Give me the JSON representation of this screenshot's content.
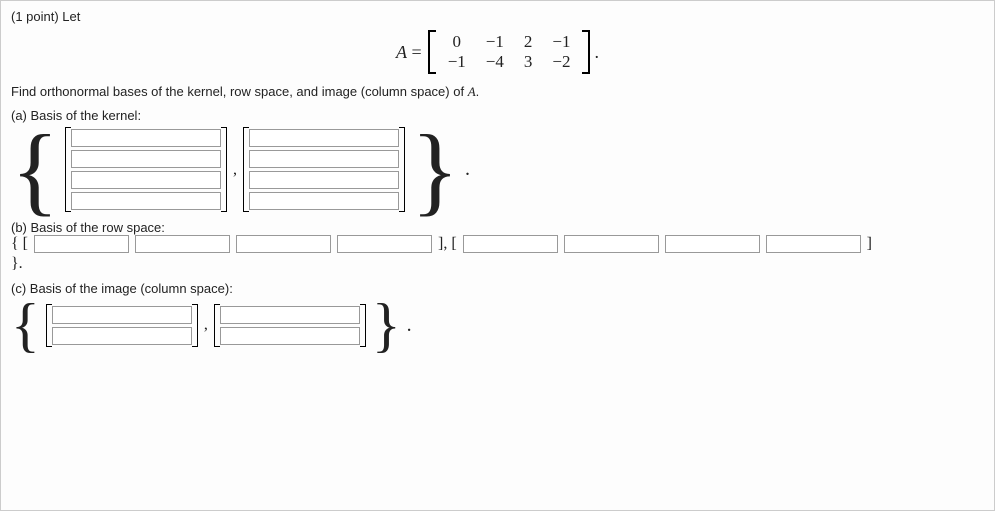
{
  "header": {
    "points": "(1 point) Let"
  },
  "matrix": {
    "label": "A =",
    "rows": [
      [
        "0",
        "−1",
        "2",
        "−1"
      ],
      [
        "−1",
        "−4",
        "3",
        "−2"
      ]
    ],
    "suffix": "."
  },
  "instruction": "Find orthonormal bases of the kernel, row space, and image (column space) of A.",
  "a": {
    "label": "(a) Basis of the kernel:",
    "vec1": [
      "",
      "",
      "",
      ""
    ],
    "vec2": [
      "",
      "",
      "",
      ""
    ],
    "sep": ",",
    "dot": "."
  },
  "b": {
    "label": "(b) Basis of the row space:",
    "open": "{ [",
    "mid": "], [",
    "close": "]",
    "close2": "}.",
    "v1": [
      "",
      "",
      "",
      ""
    ],
    "v2": [
      "",
      "",
      "",
      ""
    ]
  },
  "c": {
    "label": "(c) Basis of the image (column space):",
    "v1": [
      "",
      ""
    ],
    "v2": [
      "",
      ""
    ],
    "sep": ",",
    "dot": "."
  }
}
